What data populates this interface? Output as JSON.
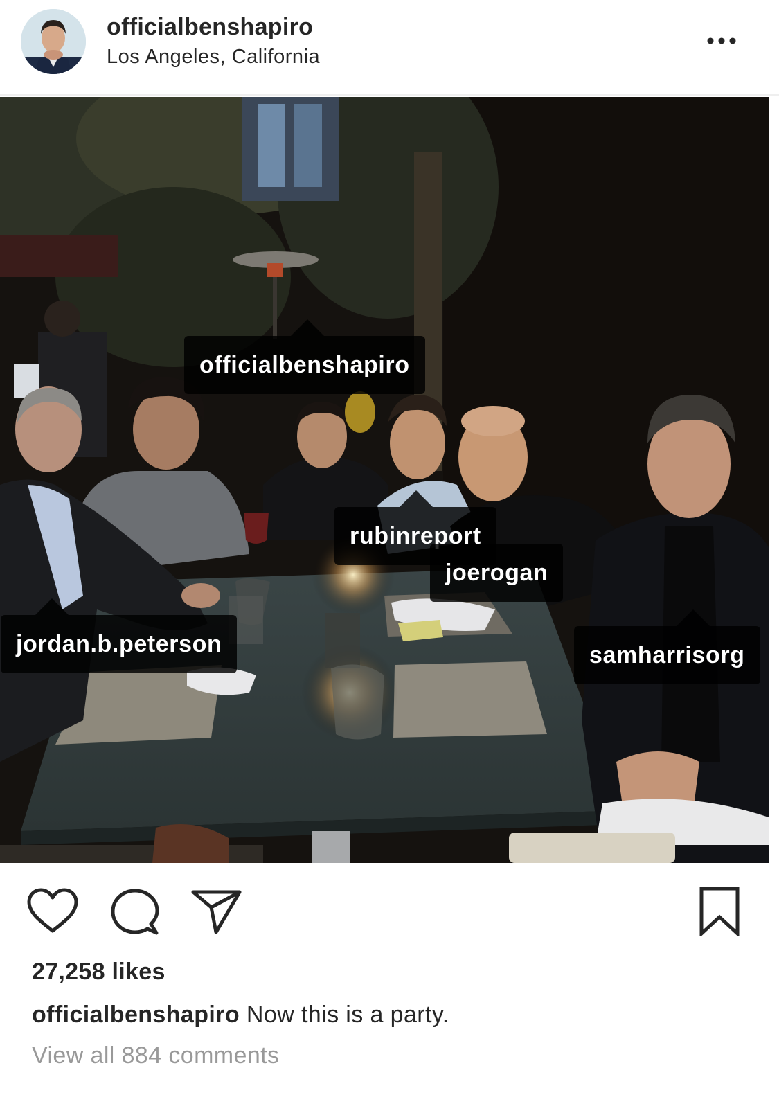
{
  "post": {
    "username": "officialbenshapiro",
    "location": "Los Angeles, California",
    "likes": "27,258 likes",
    "caption_user": "officialbenshapiro",
    "caption_text": "Now this is a party.",
    "view_comments": "View all 884 comments"
  },
  "photo_tags": [
    {
      "label": "officialbenshapiro"
    },
    {
      "label": "rubinreport"
    },
    {
      "label": "joerogan"
    },
    {
      "label": "jordan.b.peterson"
    },
    {
      "label": "samharrisorg"
    }
  ],
  "icons": {
    "more": "more-options-icon",
    "like": "heart-icon",
    "comment": "comment-icon",
    "share": "paper-plane-icon",
    "save": "bookmark-icon"
  },
  "colors": {
    "text": "#262626",
    "muted": "#999999",
    "tag_background": "#000000"
  }
}
